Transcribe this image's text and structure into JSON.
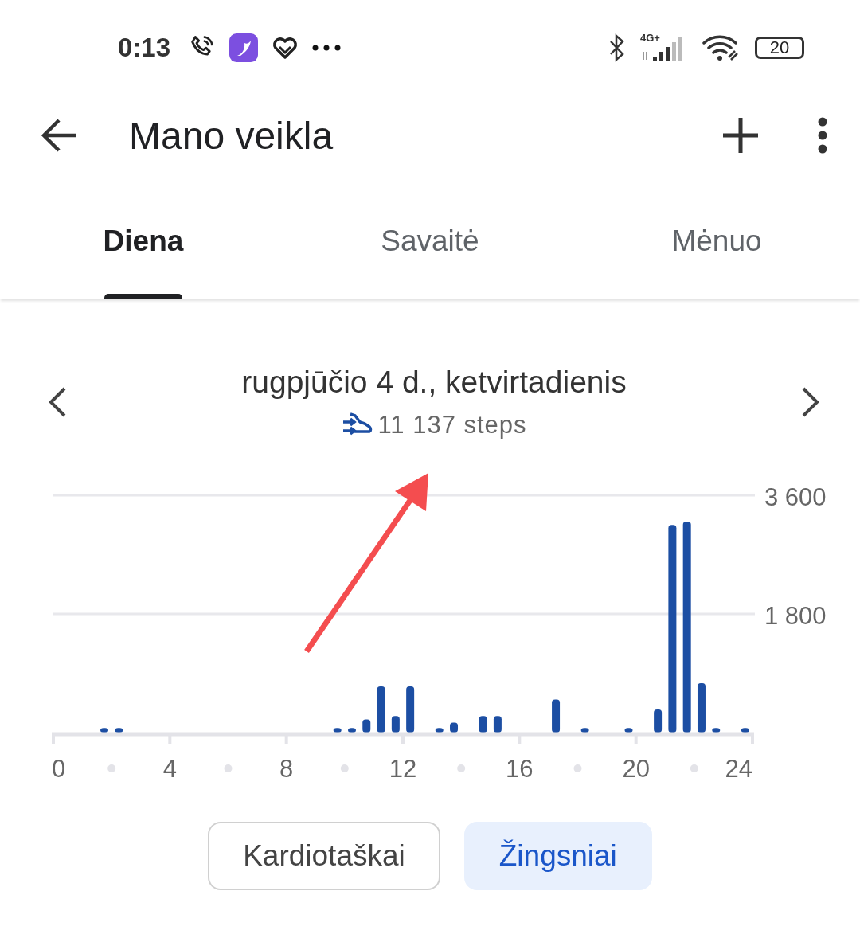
{
  "status_bar": {
    "time": "0:13",
    "battery": "20",
    "network": "4G+"
  },
  "app_bar": {
    "title": "Mano veikla"
  },
  "tabs": [
    {
      "label": "Diena",
      "selected": true
    },
    {
      "label": "Savaitė",
      "selected": false
    },
    {
      "label": "Mėnuo",
      "selected": false
    }
  ],
  "date_nav": {
    "title": "rugpjūčio 4 d., ketvirtadienis",
    "steps": "11 137 steps"
  },
  "chart_data": {
    "type": "bar",
    "x": [
      1.75,
      2.25,
      9.75,
      10.25,
      10.75,
      11.25,
      11.75,
      12.25,
      13.25,
      13.75,
      14.75,
      15.25,
      17.25,
      18.25,
      19.75,
      20.75,
      21.25,
      21.75,
      22.25,
      22.75,
      23.75
    ],
    "series": [
      {
        "color": "#1c4ea3",
        "values": [
          70,
          70,
          70,
          70,
          200,
          700,
          250,
          700,
          70,
          150,
          250,
          250,
          500,
          70,
          70,
          350,
          3150,
          3200,
          750,
          70,
          70
        ]
      }
    ],
    "xlim": [
      0,
      24
    ],
    "ylim": [
      0,
      3600
    ],
    "xticks": [
      0,
      4,
      8,
      12,
      16,
      20,
      24
    ],
    "yticks": [
      {
        "value": 1800,
        "label": "1 800"
      },
      {
        "value": 3600,
        "label": "3 600"
      }
    ]
  },
  "metric_buttons": [
    {
      "label": "Kardiotaškai",
      "selected": false
    },
    {
      "label": "Žingsniai",
      "selected": true
    }
  ]
}
